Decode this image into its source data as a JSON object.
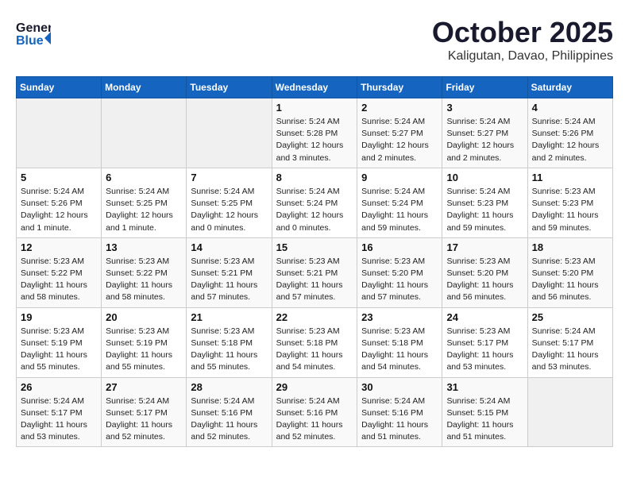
{
  "header": {
    "logo_general": "General",
    "logo_blue": "Blue",
    "month": "October 2025",
    "location": "Kaligutan, Davao, Philippines"
  },
  "weekdays": [
    "Sunday",
    "Monday",
    "Tuesday",
    "Wednesday",
    "Thursday",
    "Friday",
    "Saturday"
  ],
  "weeks": [
    [
      {
        "day": "",
        "info": ""
      },
      {
        "day": "",
        "info": ""
      },
      {
        "day": "",
        "info": ""
      },
      {
        "day": "1",
        "info": "Sunrise: 5:24 AM\nSunset: 5:28 PM\nDaylight: 12 hours\nand 3 minutes."
      },
      {
        "day": "2",
        "info": "Sunrise: 5:24 AM\nSunset: 5:27 PM\nDaylight: 12 hours\nand 2 minutes."
      },
      {
        "day": "3",
        "info": "Sunrise: 5:24 AM\nSunset: 5:27 PM\nDaylight: 12 hours\nand 2 minutes."
      },
      {
        "day": "4",
        "info": "Sunrise: 5:24 AM\nSunset: 5:26 PM\nDaylight: 12 hours\nand 2 minutes."
      }
    ],
    [
      {
        "day": "5",
        "info": "Sunrise: 5:24 AM\nSunset: 5:26 PM\nDaylight: 12 hours\nand 1 minute."
      },
      {
        "day": "6",
        "info": "Sunrise: 5:24 AM\nSunset: 5:25 PM\nDaylight: 12 hours\nand 1 minute."
      },
      {
        "day": "7",
        "info": "Sunrise: 5:24 AM\nSunset: 5:25 PM\nDaylight: 12 hours\nand 0 minutes."
      },
      {
        "day": "8",
        "info": "Sunrise: 5:24 AM\nSunset: 5:24 PM\nDaylight: 12 hours\nand 0 minutes."
      },
      {
        "day": "9",
        "info": "Sunrise: 5:24 AM\nSunset: 5:24 PM\nDaylight: 11 hours\nand 59 minutes."
      },
      {
        "day": "10",
        "info": "Sunrise: 5:24 AM\nSunset: 5:23 PM\nDaylight: 11 hours\nand 59 minutes."
      },
      {
        "day": "11",
        "info": "Sunrise: 5:23 AM\nSunset: 5:23 PM\nDaylight: 11 hours\nand 59 minutes."
      }
    ],
    [
      {
        "day": "12",
        "info": "Sunrise: 5:23 AM\nSunset: 5:22 PM\nDaylight: 11 hours\nand 58 minutes."
      },
      {
        "day": "13",
        "info": "Sunrise: 5:23 AM\nSunset: 5:22 PM\nDaylight: 11 hours\nand 58 minutes."
      },
      {
        "day": "14",
        "info": "Sunrise: 5:23 AM\nSunset: 5:21 PM\nDaylight: 11 hours\nand 57 minutes."
      },
      {
        "day": "15",
        "info": "Sunrise: 5:23 AM\nSunset: 5:21 PM\nDaylight: 11 hours\nand 57 minutes."
      },
      {
        "day": "16",
        "info": "Sunrise: 5:23 AM\nSunset: 5:20 PM\nDaylight: 11 hours\nand 57 minutes."
      },
      {
        "day": "17",
        "info": "Sunrise: 5:23 AM\nSunset: 5:20 PM\nDaylight: 11 hours\nand 56 minutes."
      },
      {
        "day": "18",
        "info": "Sunrise: 5:23 AM\nSunset: 5:20 PM\nDaylight: 11 hours\nand 56 minutes."
      }
    ],
    [
      {
        "day": "19",
        "info": "Sunrise: 5:23 AM\nSunset: 5:19 PM\nDaylight: 11 hours\nand 55 minutes."
      },
      {
        "day": "20",
        "info": "Sunrise: 5:23 AM\nSunset: 5:19 PM\nDaylight: 11 hours\nand 55 minutes."
      },
      {
        "day": "21",
        "info": "Sunrise: 5:23 AM\nSunset: 5:18 PM\nDaylight: 11 hours\nand 55 minutes."
      },
      {
        "day": "22",
        "info": "Sunrise: 5:23 AM\nSunset: 5:18 PM\nDaylight: 11 hours\nand 54 minutes."
      },
      {
        "day": "23",
        "info": "Sunrise: 5:23 AM\nSunset: 5:18 PM\nDaylight: 11 hours\nand 54 minutes."
      },
      {
        "day": "24",
        "info": "Sunrise: 5:23 AM\nSunset: 5:17 PM\nDaylight: 11 hours\nand 53 minutes."
      },
      {
        "day": "25",
        "info": "Sunrise: 5:24 AM\nSunset: 5:17 PM\nDaylight: 11 hours\nand 53 minutes."
      }
    ],
    [
      {
        "day": "26",
        "info": "Sunrise: 5:24 AM\nSunset: 5:17 PM\nDaylight: 11 hours\nand 53 minutes."
      },
      {
        "day": "27",
        "info": "Sunrise: 5:24 AM\nSunset: 5:17 PM\nDaylight: 11 hours\nand 52 minutes."
      },
      {
        "day": "28",
        "info": "Sunrise: 5:24 AM\nSunset: 5:16 PM\nDaylight: 11 hours\nand 52 minutes."
      },
      {
        "day": "29",
        "info": "Sunrise: 5:24 AM\nSunset: 5:16 PM\nDaylight: 11 hours\nand 52 minutes."
      },
      {
        "day": "30",
        "info": "Sunrise: 5:24 AM\nSunset: 5:16 PM\nDaylight: 11 hours\nand 51 minutes."
      },
      {
        "day": "31",
        "info": "Sunrise: 5:24 AM\nSunset: 5:15 PM\nDaylight: 11 hours\nand 51 minutes."
      },
      {
        "day": "",
        "info": ""
      }
    ]
  ]
}
